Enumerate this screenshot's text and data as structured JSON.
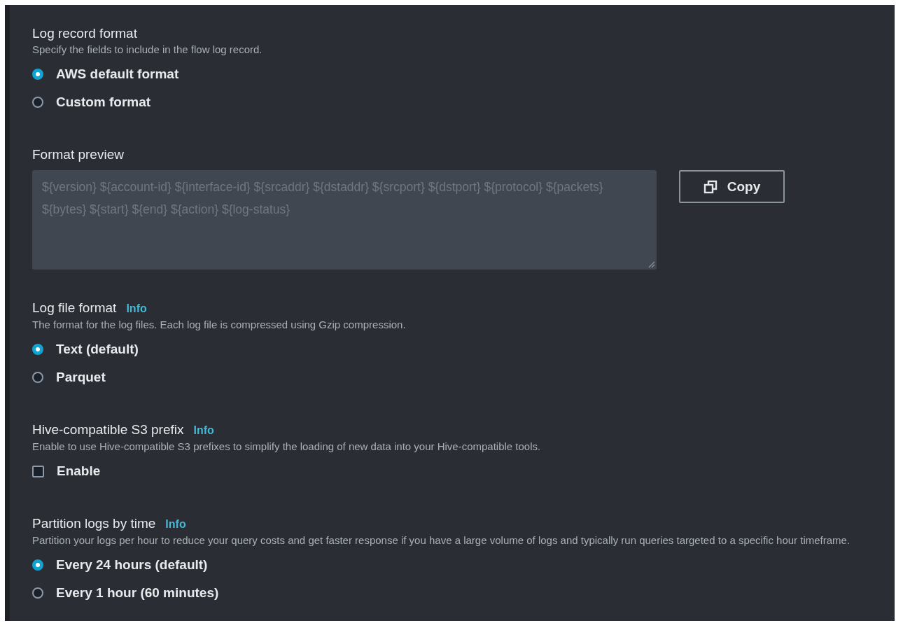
{
  "sections": [
    {
      "kind": "radio",
      "label": "Log record format",
      "description": "Specify the fields to include in the flow log record.",
      "options": [
        {
          "label": "AWS default format",
          "selected": true
        },
        {
          "label": "Custom format",
          "selected": false
        }
      ]
    },
    {
      "kind": "preview",
      "label": "Format preview",
      "value": "${version} ${account-id} ${interface-id} ${srcaddr} ${dstaddr} ${srcport} ${dstport} ${protocol} ${packets} ${bytes} ${start} ${end} ${action} ${log-status}",
      "button": "Copy"
    },
    {
      "kind": "radio",
      "label": "Log file format",
      "info": "Info",
      "description": "The format for the log files. Each log file is compressed using Gzip compression.",
      "options": [
        {
          "label": "Text (default)",
          "selected": true
        },
        {
          "label": "Parquet",
          "selected": false
        }
      ]
    },
    {
      "kind": "checkbox",
      "label": "Hive-compatible S3 prefix",
      "info": "Info",
      "description": "Enable to use Hive-compatible S3 prefixes to simplify the loading of new data into your Hive-compatible tools.",
      "options": [
        {
          "label": "Enable",
          "checked": false
        }
      ]
    },
    {
      "kind": "radio",
      "label": "Partition logs by time",
      "info": "Info",
      "description": "Partition your logs per hour to reduce your query costs and get faster response if you have a large volume of logs and typically run queries targeted to a specific hour timeframe.",
      "options": [
        {
          "label": "Every 24 hours (default)",
          "selected": true
        },
        {
          "label": "Every 1 hour (60 minutes)",
          "selected": false
        }
      ]
    }
  ]
}
